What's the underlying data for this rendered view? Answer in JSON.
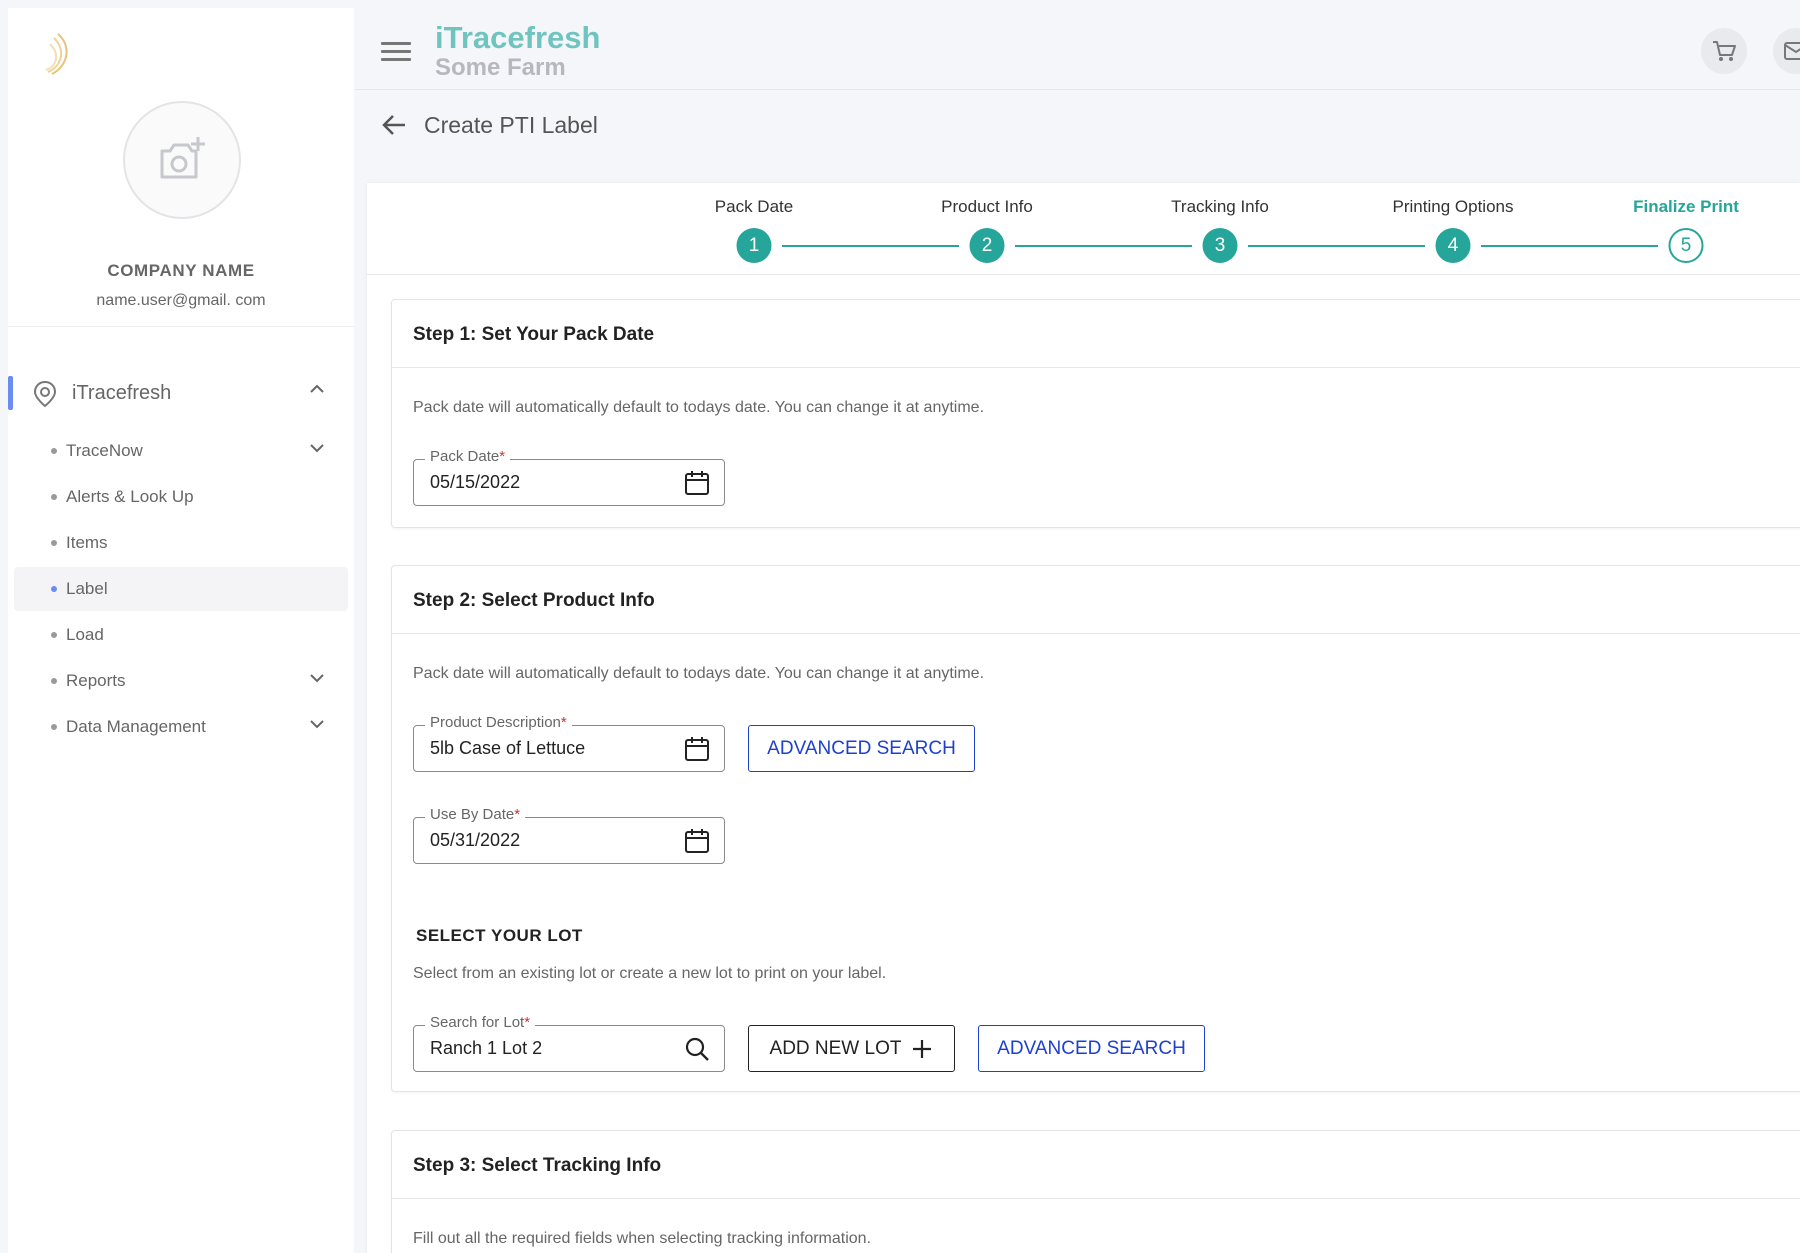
{
  "sidebar": {
    "company_name": "COMPANY NAME",
    "email": "name.user@gmail. com",
    "main_section": "iTracefresh",
    "items": [
      {
        "label": "TraceNow"
      },
      {
        "label": "Alerts & Look Up"
      },
      {
        "label": "Items"
      },
      {
        "label": "Label"
      },
      {
        "label": "Load"
      },
      {
        "label": "Reports"
      },
      {
        "label": "Data Management"
      }
    ],
    "active_item": "Label"
  },
  "header": {
    "brand": "iTracefresh",
    "farm": "Some Farm"
  },
  "page": {
    "title": "Create PTI Label"
  },
  "stepper": {
    "steps": [
      {
        "label": "Pack Date",
        "number": "1"
      },
      {
        "label": "Product Info",
        "number": "2"
      },
      {
        "label": "Tracking Info",
        "number": "3"
      },
      {
        "label": "Printing Options",
        "number": "4"
      },
      {
        "label": "Finalize Print",
        "number": "5"
      }
    ],
    "current_step": 5
  },
  "step1": {
    "title": "Step 1: Set Your Pack Date",
    "description": "Pack date will automatically default to todays date. You can change it at anytime.",
    "pack_date_label": "Pack Date",
    "pack_date_value": "05/15/2022"
  },
  "step2": {
    "title": "Step 2: Select Product Info",
    "description": "Pack date will automatically default to todays date. You can change it at anytime.",
    "product_label": "Product Description",
    "product_value": "5lb Case of Lettuce",
    "advanced_search": "ADVANCED SEARCH",
    "use_by_label": "Use By Date",
    "use_by_value": "05/31/2022",
    "lot_title": "SELECT YOUR LOT",
    "lot_description": "Select from an existing lot or create a new lot to print on your label.",
    "lot_label": "Search for Lot",
    "lot_value": "Ranch 1 Lot 2",
    "add_lot": "ADD NEW LOT",
    "lot_advanced_search": "ADVANCED SEARCH"
  },
  "step3": {
    "title": "Step 3: Select Tracking Info",
    "description": "Fill out all the required fields when selecting tracking information."
  },
  "required_marker": "*",
  "colors": {
    "accent": "#26a69a",
    "brand": "#6fc4c0",
    "link_blue": "#1e40d0",
    "nav_active": "#6b8cf0"
  }
}
